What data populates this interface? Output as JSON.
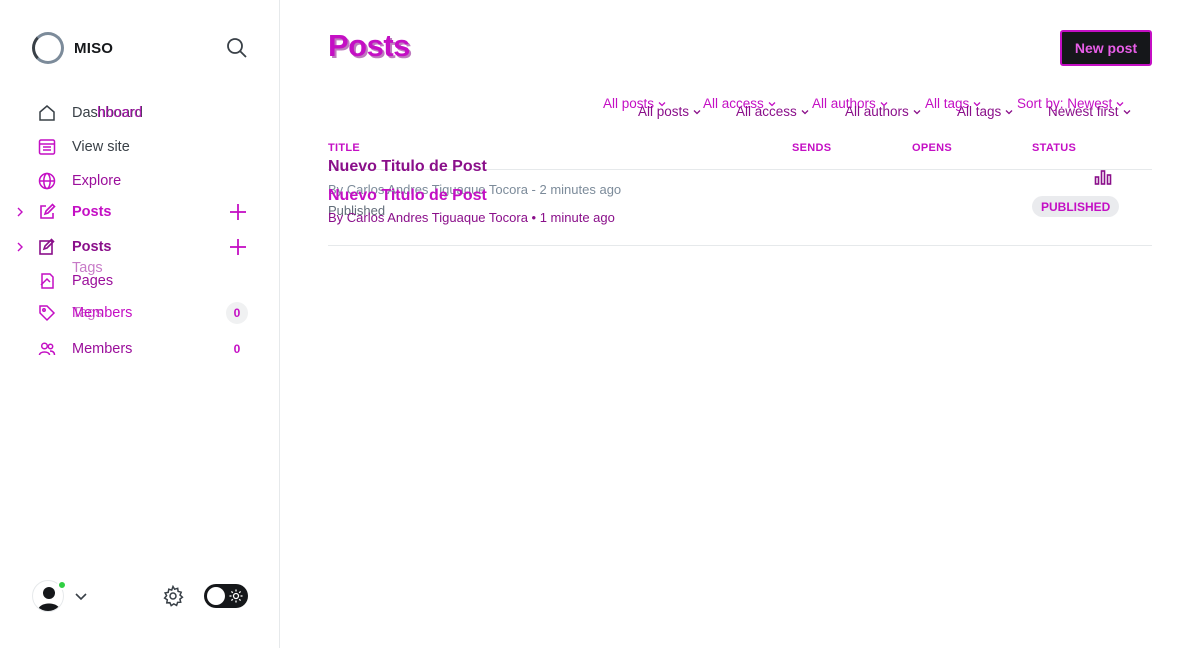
{
  "brand": {
    "name": "MISO"
  },
  "sidebar": {
    "items": [
      {
        "label": "Dashboard",
        "overlay": "hboard"
      },
      {
        "label": "View site"
      },
      {
        "label": "Explore"
      },
      {
        "label": "Posts"
      },
      {
        "label": "Posts"
      },
      {
        "label": "Pages",
        "ghost": "Tags"
      },
      {
        "label": "Members",
        "ghost": "Tags",
        "count": "0"
      },
      {
        "label": "Members",
        "count": "0"
      }
    ]
  },
  "main": {
    "title": "Posts",
    "new_post_label": "New post",
    "filters_top": [
      "All posts",
      "All access",
      "All authors",
      "All tags",
      "Sort by: Newest"
    ],
    "filters_bottom": [
      "All posts",
      "All access",
      "All authors",
      "All tags",
      "Newest first"
    ],
    "columns": [
      "TITLE",
      "SENDS",
      "OPENS",
      "STATUS"
    ],
    "posts": [
      {
        "title": "Nuevo Titulo de Post",
        "meta": "By Carlos Andres Tiguaque Tocora - 2 minutes ago",
        "status_text": "Published",
        "title_b": "Nuevo Titulo de Post",
        "meta_b": "By Carlos Andres Tiguaque Tocora • 1 minute ago",
        "badge": "PUBLISHED"
      }
    ]
  },
  "colors": {
    "accent": "#c40fc4",
    "dark": "#15171a",
    "online": "#30cf43"
  }
}
